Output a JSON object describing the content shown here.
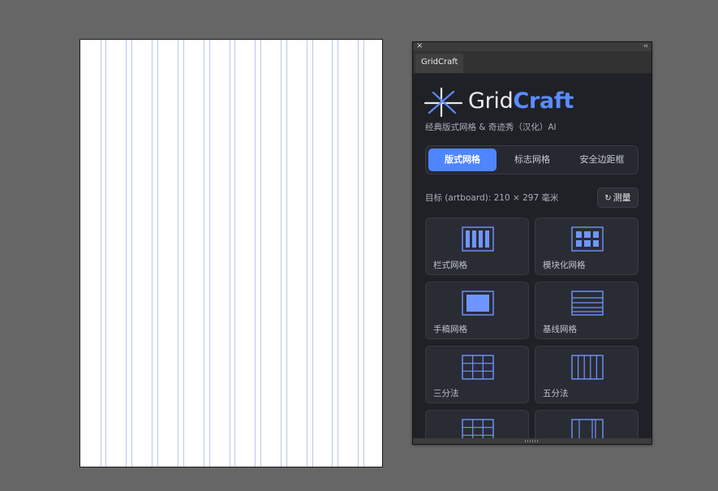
{
  "panel": {
    "close_glyph": "×",
    "collapse_glyph": "‹‹",
    "tab_label": "GridCraft",
    "brand_grid": "Grid",
    "brand_craft": "Craft",
    "subtitle": "经典版式网格 & 奇迹秀（汉化）AI",
    "segments": [
      {
        "label": "版式网格",
        "active": true
      },
      {
        "label": "标志网格",
        "active": false
      },
      {
        "label": "安全边距框",
        "active": false
      }
    ],
    "target_text": "目标 (artboard): 210 × 297 毫米",
    "measure_icon": "↻",
    "measure_label": "测量",
    "cards": [
      {
        "label": "栏式网格",
        "icon": "columns-grid-icon"
      },
      {
        "label": "模块化网格",
        "icon": "modular-grid-icon"
      },
      {
        "label": "手稿网格",
        "icon": "manuscript-grid-icon"
      },
      {
        "label": "基线网格",
        "icon": "baseline-grid-icon"
      },
      {
        "label": "三分法",
        "icon": "rule-of-thirds-icon"
      },
      {
        "label": "五分法",
        "icon": "rule-of-fifths-icon"
      },
      {
        "label": "",
        "icon": "grid-icon"
      },
      {
        "label": "",
        "icon": "split-columns-icon"
      }
    ]
  },
  "colors": {
    "accent": "#4f86ff",
    "panel_bg": "#1f2127",
    "card_bg": "#2a2c33",
    "guide": "#b9c7ea",
    "canvas_bg": "#666666"
  }
}
